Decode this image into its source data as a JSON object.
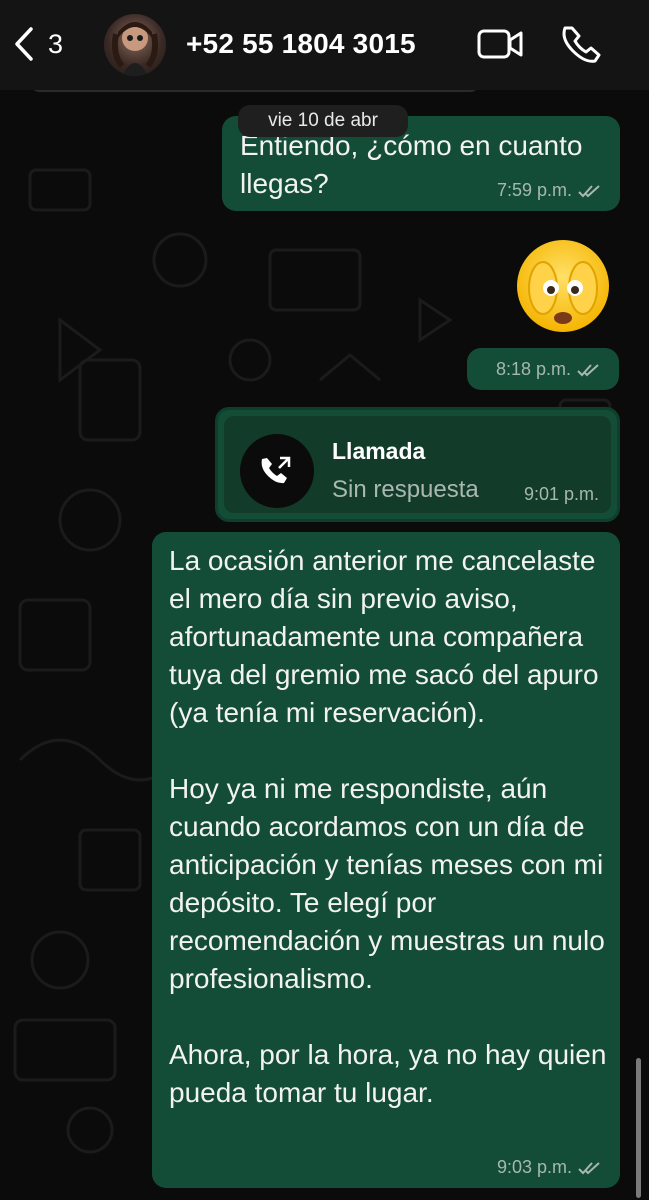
{
  "header": {
    "back_count": "3",
    "contact": "+52 55 1804 3015"
  },
  "date_pill": "vie 10 de abr",
  "messages": [
    {
      "text": "Entiendo, ¿cómo en cuanto llegas?",
      "time": "7:59 p.m."
    },
    {
      "emoji": "face-with-hands-over-eyes",
      "time": "8:18 p.m."
    },
    {
      "type": "call",
      "title": "Llamada",
      "subtitle": "Sin respuesta",
      "time": "9:01 p.m."
    },
    {
      "text": "La ocasión anterior me cancelaste el mero día sin previo aviso, afortunadamente una compañera tuya del gremio me sacó del apuro (ya tenía mi reservación).\n\nHoy ya ni me respondiste, aún cuando acordamos con un día de anticipación y tenías meses con mi depósito. Te elegí por recomendación y muestras un nulo profesionalismo.\n\nAhora, por la hora, ya no hay quien pueda tomar tu lugar.",
      "time": "9:03 p.m."
    }
  ],
  "icons": {
    "back": "chevron-left-icon",
    "video": "video-call-icon",
    "phone": "phone-icon",
    "call": "outgoing-call-icon",
    "read": "double-check-icon"
  },
  "colors": {
    "bubble": "#134d37",
    "background": "#0b0b0b",
    "header": "#141414"
  }
}
